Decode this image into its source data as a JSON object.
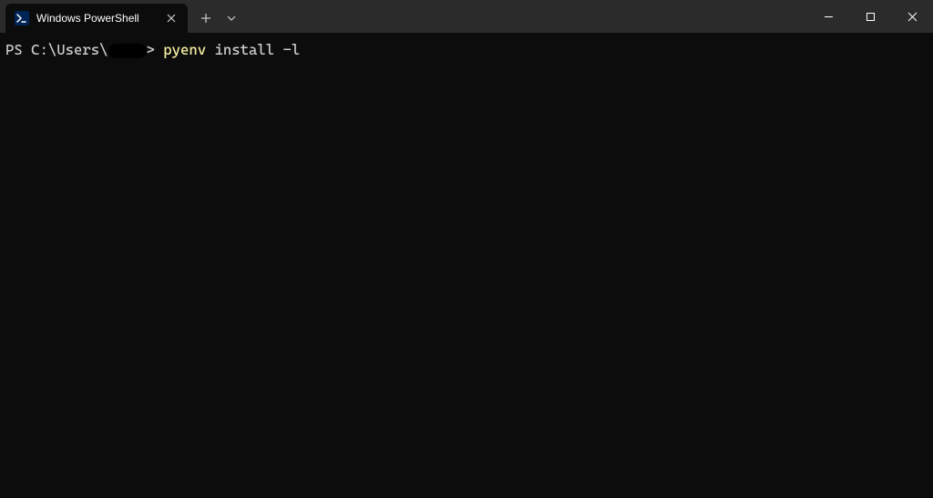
{
  "titlebar": {
    "tab_title": "Windows PowerShell",
    "tab_icon_name": "powershell-icon",
    "close_glyph": "✕",
    "new_tab_glyph": "+",
    "dropdown_glyph": "⌄"
  },
  "window_controls": {
    "minimize_glyph": "—",
    "maximize_glyph": "▢",
    "close_glyph": "✕"
  },
  "terminal": {
    "ps_prefix": "PS ",
    "path_prefix": "C:\\Users\\",
    "caret": ">",
    "command_exec": "pyenv",
    "command_args": " install -l"
  },
  "colors": {
    "titlebar_bg": "#2b2b2b",
    "active_tab_bg": "#0c0c0c",
    "terminal_bg": "#0c0c0c",
    "prompt_text": "#cccccc",
    "command_highlight": "#f9f1a5"
  }
}
